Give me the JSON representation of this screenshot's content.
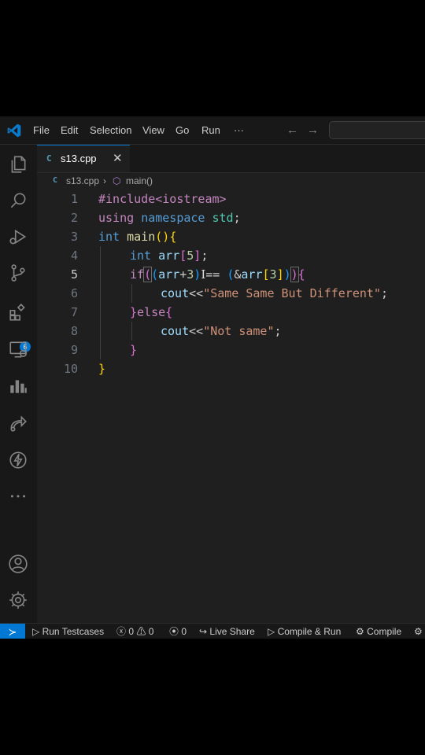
{
  "menu": {
    "file": "File",
    "edit": "Edit",
    "selection": "Selection",
    "view": "View",
    "go": "Go",
    "run": "Run",
    "more": "···"
  },
  "nav": {
    "back": "←",
    "forward": "→"
  },
  "activity": {
    "extensions_badge": "6"
  },
  "tab": {
    "icon": "C",
    "label": "s13.cpp",
    "close": "✕"
  },
  "breadcrumb": {
    "file": "s13.cpp",
    "symbol": "main()"
  },
  "code": {
    "l1": {
      "n": "1",
      "text": "#include<iostream>"
    },
    "l2": {
      "n": "2",
      "kw": "using",
      "kw_ns": "namespace",
      "name": "std",
      "end": ";"
    },
    "l3": {
      "n": "3",
      "type": "int",
      "fn": "main",
      "paren": "()",
      "brace": "{"
    },
    "l4": {
      "n": "4",
      "type": "int",
      "var": "arr",
      "b": "[",
      "num": "5",
      "b2": "]",
      "end": ";"
    },
    "l5": {
      "n": "5",
      "kw": "if",
      "p1": "(",
      "p2": "(",
      "var": "arr",
      "op": "+",
      "num": "3",
      "p3": ")",
      "cursor": "I",
      "eq": "== ",
      "p4": "(",
      "amp": "&",
      "var2": "arr",
      "b": "[",
      "num2": "3",
      "b2": "]",
      "p5": ")",
      "p6": ")",
      "brace": "{"
    },
    "l6": {
      "n": "6",
      "var": "cout",
      "op": "<<",
      "str": "\"Same Same But Different\"",
      "end": ";"
    },
    "l7": {
      "n": "7",
      "brace1": "}",
      "kw": "else",
      "brace2": "{"
    },
    "l8": {
      "n": "8",
      "var": "cout",
      "op": "<<",
      "str": "\"Not same\"",
      "end": ";"
    },
    "l9": {
      "n": "9",
      "brace": "}"
    },
    "l10": {
      "n": "10",
      "brace": "}"
    }
  },
  "status": {
    "remote": "≻",
    "run_testcases": "Run Testcases",
    "errors": "0",
    "warnings": "0",
    "ports": "0",
    "live_share": "Live Share",
    "compile_run": "Compile & Run",
    "compile": "Compile"
  }
}
